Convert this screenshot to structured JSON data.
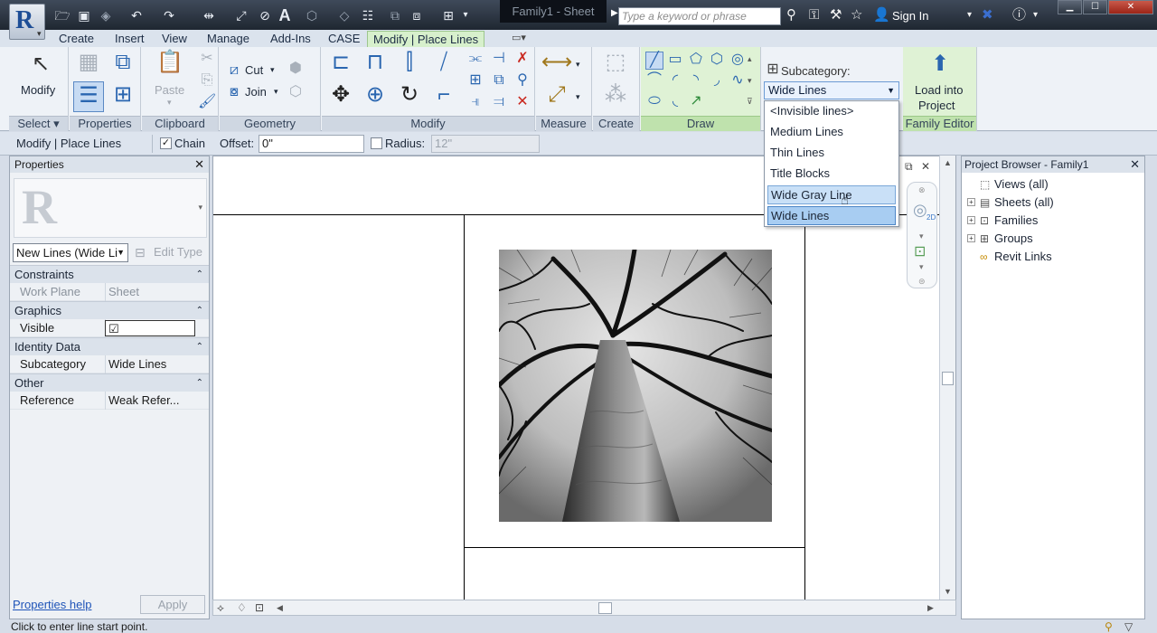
{
  "title_bar": {
    "doc_title": "Family1 - Sheet",
    "search_placeholder": "Type a keyword or phrase",
    "sign_in": "Sign In"
  },
  "tabs": [
    "Create",
    "Insert",
    "View",
    "Manage",
    "Add-Ins",
    "CASE",
    "Modify | Place Lines"
  ],
  "ribbon": {
    "modify_label": "Modify",
    "paste_label": "Paste",
    "cut_label": "Cut",
    "join_label": "Join",
    "subcategory_label": "Subcategory:",
    "subcategory_value": "Wide Lines",
    "load_into_project": [
      "Load into",
      "Project"
    ],
    "panels": {
      "select": "Select",
      "properties": "Properties",
      "clipboard": "Clipboard",
      "geometry": "Geometry",
      "modify": "Modify",
      "measure": "Measure",
      "create": "Create",
      "draw": "Draw",
      "family_editor": "Family Editor"
    }
  },
  "subcategory_options": [
    "<Invisible lines>",
    "Medium Lines",
    "Thin Lines",
    "Title Blocks",
    "Wide Gray Line",
    "Wide Lines"
  ],
  "options_bar": {
    "context": "Modify | Place Lines",
    "chain_label": "Chain",
    "offset_label": "Offset:",
    "offset_value": "0\"",
    "radius_label": "Radius:",
    "radius_value": "12\""
  },
  "properties": {
    "title": "Properties",
    "type_selector": "New Lines (Wide Li",
    "edit_type": "Edit Type",
    "groups": {
      "constraints": "Constraints",
      "graphics": "Graphics",
      "identity": "Identity Data",
      "other": "Other"
    },
    "rows": {
      "work_plane_key": "Work Plane",
      "work_plane_val": "Sheet",
      "visible_key": "Visible",
      "visible_val": "☑",
      "subcategory_key": "Subcategory",
      "subcategory_val": "Wide Lines",
      "reference_key": "Reference",
      "reference_val": "Weak Refer..."
    },
    "help_link": "Properties help",
    "apply_button": "Apply"
  },
  "project_browser": {
    "title": "Project Browser - Family1",
    "items": [
      "Views (all)",
      "Sheets (all)",
      "Families",
      "Groups",
      "Revit Links"
    ]
  },
  "status_bar": {
    "text": "Click to enter line start point."
  }
}
